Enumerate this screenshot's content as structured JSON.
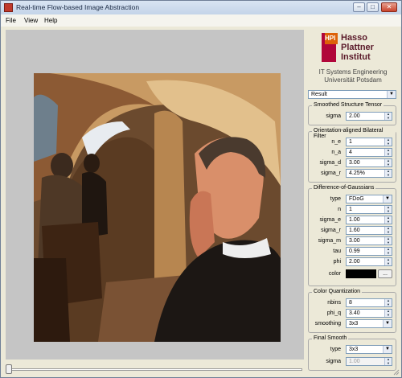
{
  "window": {
    "title": "Real-time Flow-based Image Abstraction"
  },
  "menu": {
    "items": [
      "File",
      "View",
      "Help"
    ]
  },
  "logo": {
    "mark": "HPI",
    "lines": [
      "Hasso",
      "Plattner",
      "Institut"
    ],
    "sub1": "IT Systems Engineering",
    "sub2": "Universität Potsdam"
  },
  "view_select": {
    "value": "Result"
  },
  "groups": {
    "sst": {
      "title": "Smoothed Structure Tensor",
      "sigma_label": "sigma",
      "sigma": "2.00"
    },
    "bilateral": {
      "title": "Orientation-aligned Bilateral Filter",
      "rows": [
        {
          "label": "n_e",
          "value": "1"
        },
        {
          "label": "n_a",
          "value": "4"
        },
        {
          "label": "sigma_d",
          "value": "3.00"
        },
        {
          "label": "sigma_r",
          "value": "4.25%"
        }
      ]
    },
    "dog": {
      "title": "Difference-of-Gaussians",
      "type_label": "type",
      "type_value": "FDoG",
      "rows": [
        {
          "label": "n",
          "value": "1"
        },
        {
          "label": "sigma_e",
          "value": "1.00"
        },
        {
          "label": "sigma_r",
          "value": "1.60"
        },
        {
          "label": "sigma_m",
          "value": "3.00"
        },
        {
          "label": "tau",
          "value": "0.99"
        },
        {
          "label": "phi",
          "value": "2.00"
        }
      ],
      "color_label": "color",
      "color_value": "#000000",
      "color_button": "..."
    },
    "quant": {
      "title": "Color Quantization",
      "rows": [
        {
          "label": "nbins",
          "value": "8"
        },
        {
          "label": "phi_q",
          "value": "3.40"
        }
      ],
      "smoothing_label": "smoothing",
      "smoothing_value": "3x3"
    },
    "final": {
      "title": "Final Smooth",
      "type_label": "type",
      "type_value": "3x3",
      "sigma_label": "sigma",
      "sigma_value": "1.00"
    }
  },
  "timeline": {
    "position": 0
  }
}
